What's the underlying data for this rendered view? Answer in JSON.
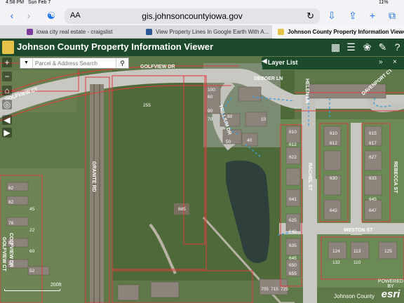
{
  "status": {
    "time": "4:58 PM",
    "date": "Sun Feb 7",
    "battery": "11%"
  },
  "browser": {
    "aa": "AA",
    "url": "gis.johnsoncountyiowa.gov"
  },
  "tabs": [
    {
      "label": "iowa city real estate - craigslist",
      "color": "#7a3b9c"
    },
    {
      "label": "View Property Lines In Google Earth With A...",
      "color": "#2b5797"
    },
    {
      "label": "Johnson County Property Information Viewer",
      "color": "#e6c24a"
    }
  ],
  "app": {
    "title": "Johnson County Property Information Viewer"
  },
  "search": {
    "placeholder": "Parcel & Address Search"
  },
  "layer_list": {
    "title": "Layer List"
  },
  "map": {
    "streets": [
      "GOLFVIEW DR",
      "GOLFVIEW CT",
      "DEBOER LN",
      "TRILLIUM DR",
      "HELEN LN",
      "DAVENPORT CT",
      "GRANITE RD",
      "RACHEL ST",
      "REBECCA ST",
      "WESTON ST",
      "GOLFVIEW CT",
      "COLFVIEW DR"
    ],
    "parcels": [
      "255",
      "685",
      "100",
      "60",
      "90",
      "70",
      "80",
      "10",
      "40",
      "50",
      "610",
      "615",
      "612",
      "617",
      "622",
      "627",
      "630",
      "633",
      "641",
      "645",
      "642",
      "647",
      "610",
      "612",
      "625",
      "635",
      "640",
      "645",
      "650",
      "655",
      "705",
      "715",
      "725",
      "124",
      "113",
      "125",
      "132",
      "110",
      "62",
      "82",
      "76",
      "84",
      "34",
      "52",
      "45",
      "22",
      "60"
    ],
    "scale": "200ft",
    "attribution": "Johnson County",
    "esri_top": "POWERED BY",
    "esri": "esri"
  }
}
